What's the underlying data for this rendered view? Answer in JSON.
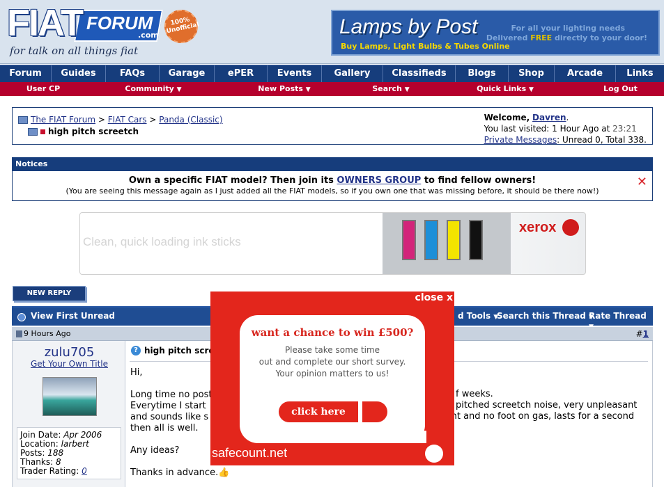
{
  "header": {
    "logo_fiat": "FIAT",
    "logo_forum": "FORUM",
    "logo_com": ".com",
    "badge": "100% Unofficial",
    "tagline": "for talk on all things fiat",
    "ad": {
      "title": "Lamps by Post",
      "sub": "Buy Lamps, Light Bulbs & Tubes Online",
      "right1": "For all your lighting needs",
      "right2a": "Delivered ",
      "right2b": "FREE",
      "right2c": " directly to your door!"
    }
  },
  "nav": {
    "main": [
      "Forum",
      "Guides",
      "FAQs",
      "Garage",
      "ePER",
      "Events",
      "Gallery",
      "Classifieds",
      "Blogs",
      "Shop",
      "Arcade",
      "Links"
    ],
    "sub": [
      "User CP",
      "Community",
      "New Posts",
      "Search",
      "Quick Links",
      "Log Out"
    ]
  },
  "breadcrumb": {
    "items": [
      "The FIAT Forum",
      "FIAT Cars",
      "Panda (Classic)"
    ],
    "sep": ">",
    "current": "high pitch screetch"
  },
  "welcome": {
    "label": "Welcome,",
    "user": "Davren",
    "last_visit": "You last visited: 1 Hour Ago at",
    "time": "23:21",
    "pm_link": "Private Messages",
    "pm_text": ": Unread 0, Total 338."
  },
  "notices": {
    "header": "Notices",
    "main_a": "Own a specific FIAT model? Then join its ",
    "main_link": "OWNERS GROUP",
    "main_b": " to find fellow owners!",
    "sub": "(You are seeing this message again as I just added all the FIAT models, so if you own one that was missing before, it should be there now!)",
    "close": "✕"
  },
  "ad_xerox": {
    "text": "Clean, quick loading ink sticks",
    "logo": "xerox"
  },
  "thread": {
    "new_reply": "NEW REPLY",
    "view_first_unread": "View First Unread",
    "thread_tools": "d Tools",
    "search_thread": "Search this Thread",
    "rate_thread": "Rate Thread"
  },
  "post": {
    "date": "9 Hours Ago",
    "num_hash": "#",
    "num": "1",
    "title": "high pitch scre",
    "username": "zulu705",
    "user_title": "Get Your Own Title",
    "join_date_label": "Join Date: ",
    "join_date": "Apr 2006",
    "location_label": "Location: ",
    "location": "larbert",
    "posts_label": "Posts: ",
    "posts": "188",
    "thanks_label": "Thanks: ",
    "thanks": "8",
    "trader_label": "Trader Rating: ",
    "trader": "0",
    "lines": {
      "hi": "Hi,",
      "l1": "Long time no post",
      "l2": "Everytime I start",
      "l3": "and sounds like s",
      "l4": "then all is well.",
      "ideas": "Any ideas?",
      "thanks": "Thanks in advance."
    },
    "right1": "f weeks.",
    "right2": "pitched screetch noise, very unpleasant",
    "right3": "int and no foot on gas, lasts for a second"
  },
  "popup": {
    "close": "close x",
    "headline": "want a chance to win £500?",
    "text1": "Please take some time",
    "text2": "out and complete our short survey.",
    "text3": "Your opinion matters to us!",
    "button": "click here",
    "brand": "safecount.net"
  },
  "colors": {
    "nav_blue": "#163d7c",
    "nav_red": "#b5002d",
    "popup_red": "#e3261c"
  }
}
